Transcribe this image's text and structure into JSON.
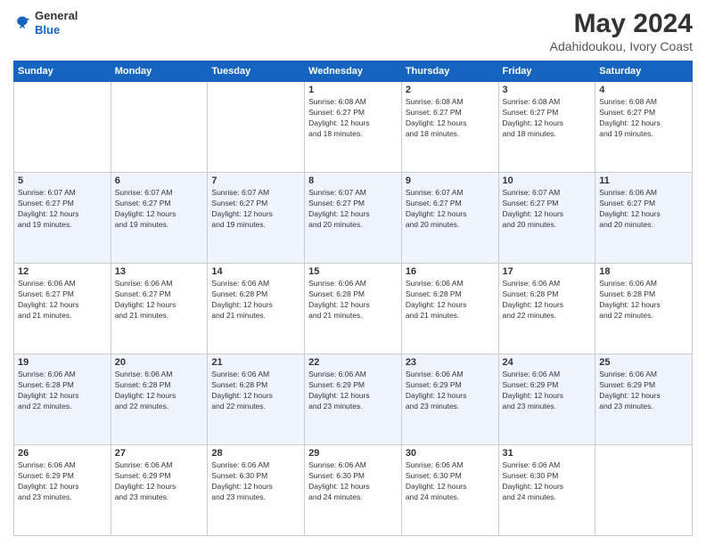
{
  "header": {
    "logo_line1": "General",
    "logo_line2": "Blue",
    "title": "May 2024",
    "location": "Adahidoukou, Ivory Coast"
  },
  "days_of_week": [
    "Sunday",
    "Monday",
    "Tuesday",
    "Wednesday",
    "Thursday",
    "Friday",
    "Saturday"
  ],
  "weeks": [
    [
      {
        "day": "",
        "info": ""
      },
      {
        "day": "",
        "info": ""
      },
      {
        "day": "",
        "info": ""
      },
      {
        "day": "1",
        "info": "Sunrise: 6:08 AM\nSunset: 6:27 PM\nDaylight: 12 hours\nand 18 minutes."
      },
      {
        "day": "2",
        "info": "Sunrise: 6:08 AM\nSunset: 6:27 PM\nDaylight: 12 hours\nand 18 minutes."
      },
      {
        "day": "3",
        "info": "Sunrise: 6:08 AM\nSunset: 6:27 PM\nDaylight: 12 hours\nand 18 minutes."
      },
      {
        "day": "4",
        "info": "Sunrise: 6:08 AM\nSunset: 6:27 PM\nDaylight: 12 hours\nand 19 minutes."
      }
    ],
    [
      {
        "day": "5",
        "info": "Sunrise: 6:07 AM\nSunset: 6:27 PM\nDaylight: 12 hours\nand 19 minutes."
      },
      {
        "day": "6",
        "info": "Sunrise: 6:07 AM\nSunset: 6:27 PM\nDaylight: 12 hours\nand 19 minutes."
      },
      {
        "day": "7",
        "info": "Sunrise: 6:07 AM\nSunset: 6:27 PM\nDaylight: 12 hours\nand 19 minutes."
      },
      {
        "day": "8",
        "info": "Sunrise: 6:07 AM\nSunset: 6:27 PM\nDaylight: 12 hours\nand 20 minutes."
      },
      {
        "day": "9",
        "info": "Sunrise: 6:07 AM\nSunset: 6:27 PM\nDaylight: 12 hours\nand 20 minutes."
      },
      {
        "day": "10",
        "info": "Sunrise: 6:07 AM\nSunset: 6:27 PM\nDaylight: 12 hours\nand 20 minutes."
      },
      {
        "day": "11",
        "info": "Sunrise: 6:06 AM\nSunset: 6:27 PM\nDaylight: 12 hours\nand 20 minutes."
      }
    ],
    [
      {
        "day": "12",
        "info": "Sunrise: 6:06 AM\nSunset: 6:27 PM\nDaylight: 12 hours\nand 21 minutes."
      },
      {
        "day": "13",
        "info": "Sunrise: 6:06 AM\nSunset: 6:27 PM\nDaylight: 12 hours\nand 21 minutes."
      },
      {
        "day": "14",
        "info": "Sunrise: 6:06 AM\nSunset: 6:28 PM\nDaylight: 12 hours\nand 21 minutes."
      },
      {
        "day": "15",
        "info": "Sunrise: 6:06 AM\nSunset: 6:28 PM\nDaylight: 12 hours\nand 21 minutes."
      },
      {
        "day": "16",
        "info": "Sunrise: 6:06 AM\nSunset: 6:28 PM\nDaylight: 12 hours\nand 21 minutes."
      },
      {
        "day": "17",
        "info": "Sunrise: 6:06 AM\nSunset: 6:28 PM\nDaylight: 12 hours\nand 22 minutes."
      },
      {
        "day": "18",
        "info": "Sunrise: 6:06 AM\nSunset: 6:28 PM\nDaylight: 12 hours\nand 22 minutes."
      }
    ],
    [
      {
        "day": "19",
        "info": "Sunrise: 6:06 AM\nSunset: 6:28 PM\nDaylight: 12 hours\nand 22 minutes."
      },
      {
        "day": "20",
        "info": "Sunrise: 6:06 AM\nSunset: 6:28 PM\nDaylight: 12 hours\nand 22 minutes."
      },
      {
        "day": "21",
        "info": "Sunrise: 6:06 AM\nSunset: 6:28 PM\nDaylight: 12 hours\nand 22 minutes."
      },
      {
        "day": "22",
        "info": "Sunrise: 6:06 AM\nSunset: 6:29 PM\nDaylight: 12 hours\nand 23 minutes."
      },
      {
        "day": "23",
        "info": "Sunrise: 6:06 AM\nSunset: 6:29 PM\nDaylight: 12 hours\nand 23 minutes."
      },
      {
        "day": "24",
        "info": "Sunrise: 6:06 AM\nSunset: 6:29 PM\nDaylight: 12 hours\nand 23 minutes."
      },
      {
        "day": "25",
        "info": "Sunrise: 6:06 AM\nSunset: 6:29 PM\nDaylight: 12 hours\nand 23 minutes."
      }
    ],
    [
      {
        "day": "26",
        "info": "Sunrise: 6:06 AM\nSunset: 6:29 PM\nDaylight: 12 hours\nand 23 minutes."
      },
      {
        "day": "27",
        "info": "Sunrise: 6:06 AM\nSunset: 6:29 PM\nDaylight: 12 hours\nand 23 minutes."
      },
      {
        "day": "28",
        "info": "Sunrise: 6:06 AM\nSunset: 6:30 PM\nDaylight: 12 hours\nand 23 minutes."
      },
      {
        "day": "29",
        "info": "Sunrise: 6:06 AM\nSunset: 6:30 PM\nDaylight: 12 hours\nand 24 minutes."
      },
      {
        "day": "30",
        "info": "Sunrise: 6:06 AM\nSunset: 6:30 PM\nDaylight: 12 hours\nand 24 minutes."
      },
      {
        "day": "31",
        "info": "Sunrise: 6:06 AM\nSunset: 6:30 PM\nDaylight: 12 hours\nand 24 minutes."
      },
      {
        "day": "",
        "info": ""
      }
    ]
  ]
}
